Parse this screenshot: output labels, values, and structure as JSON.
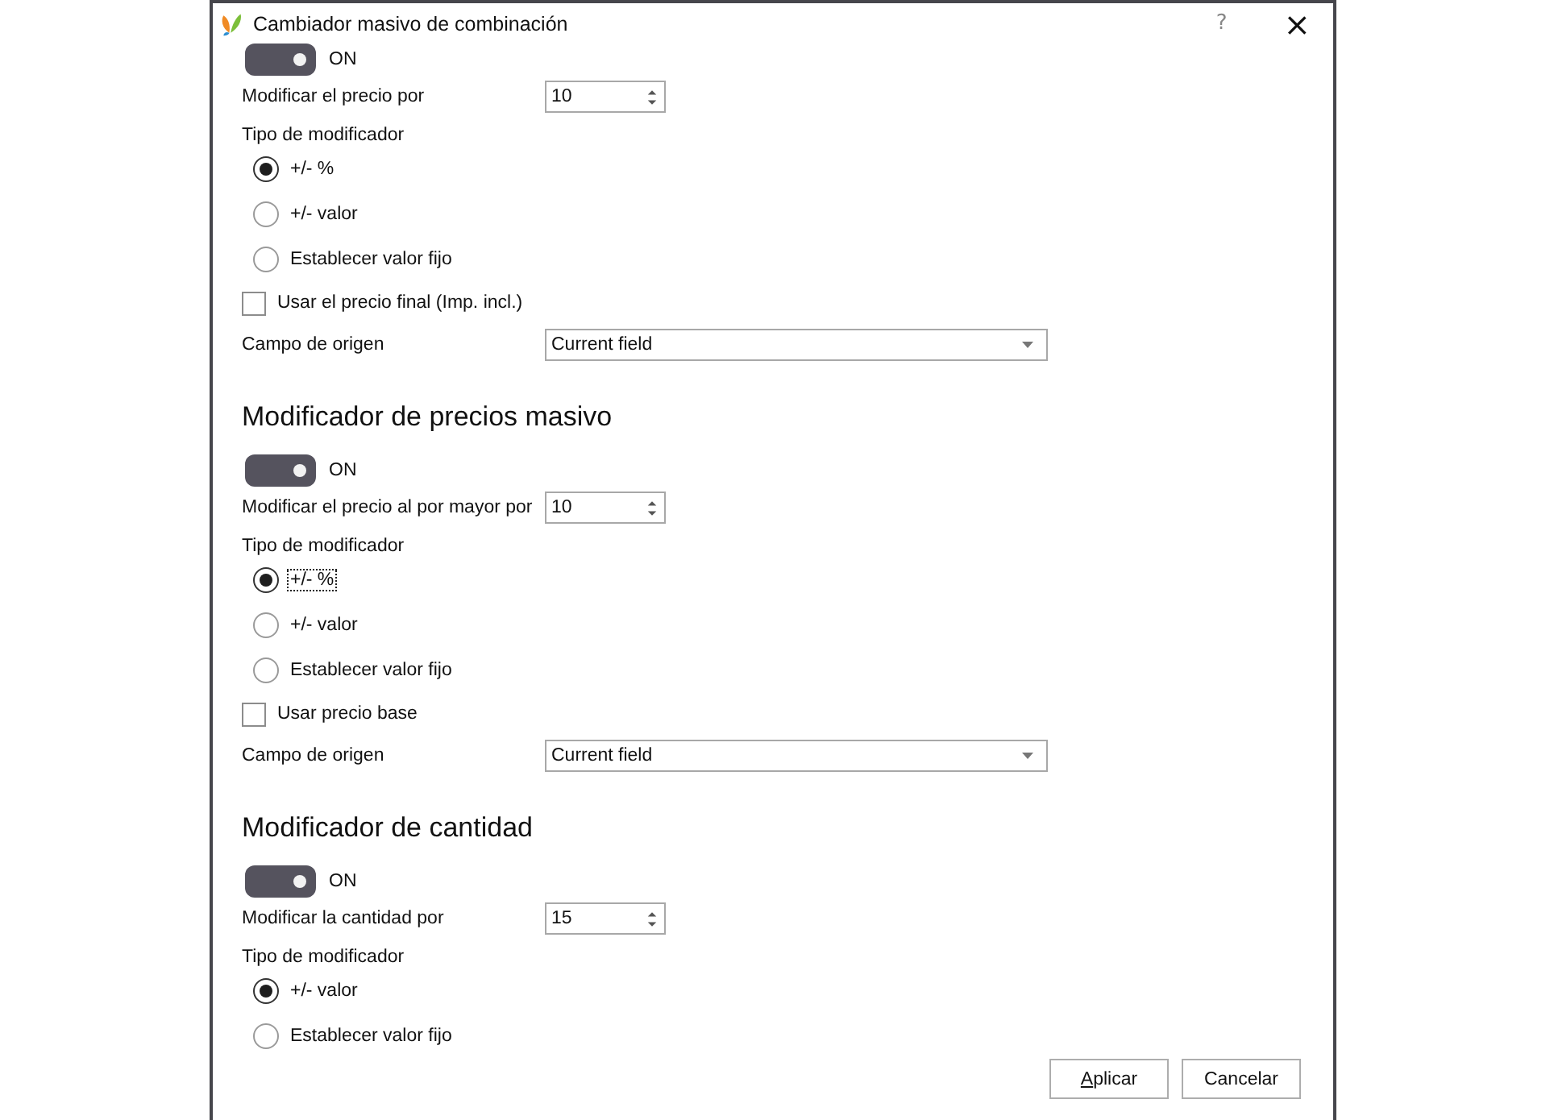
{
  "window": {
    "title": "Cambiador masivo de combinación",
    "help": "?",
    "close": "×"
  },
  "sections": [
    {
      "toggle": {
        "on": true,
        "label": "ON"
      },
      "amount": {
        "label": "Modificar el precio por",
        "value": "10"
      },
      "modifier_type": {
        "label": "Tipo de modificador",
        "options": [
          {
            "label": "+/- %",
            "selected": true,
            "focused": false
          },
          {
            "label": "+/- valor",
            "selected": false,
            "focused": false
          },
          {
            "label": "Establecer valor fijo",
            "selected": false,
            "focused": false
          }
        ]
      },
      "checkbox": {
        "label": "Usar el precio final (Imp. incl.)",
        "checked": false
      },
      "source": {
        "label": "Campo de origen",
        "value": "Current field"
      }
    },
    {
      "heading": "Modificador de precios masivo",
      "toggle": {
        "on": true,
        "label": "ON"
      },
      "amount": {
        "label": "Modificar el precio al por mayor por",
        "value": "10"
      },
      "modifier_type": {
        "label": "Tipo de modificador",
        "options": [
          {
            "label": "+/- %",
            "selected": true,
            "focused": true
          },
          {
            "label": "+/- valor",
            "selected": false,
            "focused": false
          },
          {
            "label": "Establecer valor fijo",
            "selected": false,
            "focused": false
          }
        ]
      },
      "checkbox": {
        "label": "Usar precio base",
        "checked": false
      },
      "source": {
        "label": "Campo de origen",
        "value": "Current field"
      }
    },
    {
      "heading": "Modificador de cantidad",
      "toggle": {
        "on": true,
        "label": "ON"
      },
      "amount": {
        "label": "Modificar la cantidad por",
        "value": "15"
      },
      "modifier_type": {
        "label": "Tipo de modificador",
        "options": [
          {
            "label": "+/- valor",
            "selected": true,
            "focused": false
          },
          {
            "label": "Establecer valor fijo",
            "selected": false,
            "focused": false
          }
        ]
      }
    }
  ],
  "buttons": [
    {
      "label": "Aplicar",
      "access_key": true
    },
    {
      "label": "Cancelar"
    }
  ]
}
